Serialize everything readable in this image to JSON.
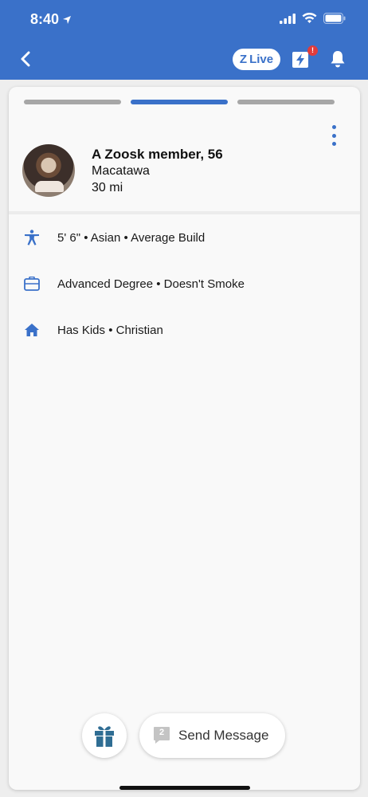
{
  "status_bar": {
    "time": "8:40"
  },
  "header": {
    "live_label": "Live",
    "live_icon_letter": "Z",
    "boost_badge": "!"
  },
  "profile": {
    "name": "A Zoosk member, 56",
    "city": "Macatawa",
    "distance": "30 mi"
  },
  "details": [
    {
      "icon": "person-icon",
      "text": "5' 6\" • Asian • Average Build"
    },
    {
      "icon": "briefcase-icon",
      "text": "Advanced Degree • Doesn't Smoke"
    },
    {
      "icon": "home-icon",
      "text": "Has Kids • Christian"
    }
  ],
  "actions": {
    "message_label": "Send Message",
    "message_count": "2"
  },
  "colors": {
    "accent": "#3a71c9",
    "badge": "#e03c3c"
  }
}
